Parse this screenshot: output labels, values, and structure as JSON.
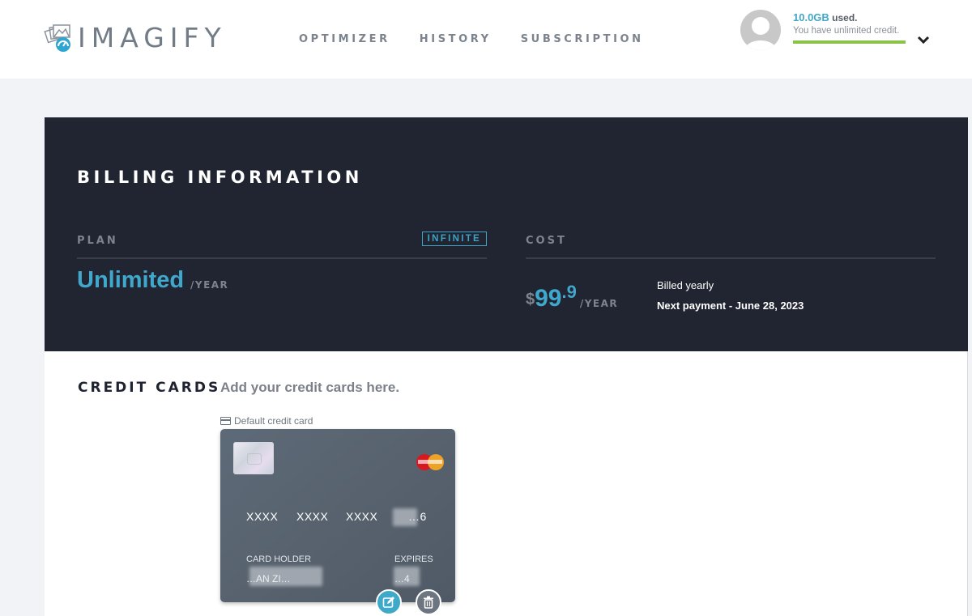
{
  "header": {
    "logo_text": "IMAGIFY",
    "nav": [
      {
        "label": "OPTIMIZER"
      },
      {
        "label": "HISTORY"
      },
      {
        "label": "SUBSCRIPTION"
      }
    ],
    "account": {
      "usage_amount": "10.0GB",
      "usage_suffix": "used.",
      "credit_text": "You have unlimited credit.",
      "usage_fill_percent": 100,
      "usage_bar_color": "#8bc34a"
    }
  },
  "billing": {
    "title": "BILLING INFORMATION",
    "plan": {
      "label": "PLAN",
      "badge": "INFINITE",
      "name": "Unlimited",
      "period": "/YEAR"
    },
    "cost": {
      "label": "COST",
      "currency": "$",
      "amount_int": "99",
      "amount_dec": ".9",
      "period": "/YEAR",
      "billed_text": "Billed yearly",
      "next_payment": "Next payment - June 28, 2023"
    },
    "accent_color": "#40a8cc"
  },
  "credit_cards": {
    "title": "CREDIT CARDS",
    "subtitle": "Add your credit cards here.",
    "default_label": "Default credit card",
    "card": {
      "brand": "mastercard",
      "number_groups": [
        "XXXX",
        "XXXX",
        "XXXX",
        "…6"
      ],
      "holder_label": "CARD HOLDER",
      "holder_value": "…AN ZI…",
      "expires_label": "EXPIRES",
      "expires_value": "…4"
    },
    "actions": {
      "edit": "edit-icon",
      "delete": "trash-icon"
    }
  }
}
